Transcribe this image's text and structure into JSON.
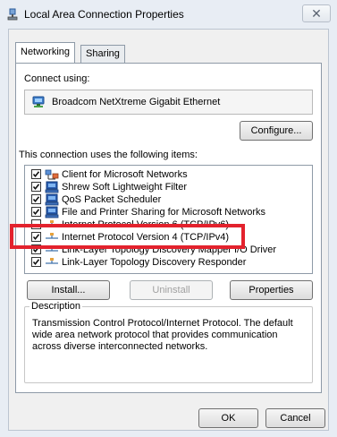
{
  "window": {
    "title": "Local Area Connection Properties",
    "close_glyph": "✕"
  },
  "tabs": [
    {
      "label": "Networking",
      "selected": true
    },
    {
      "label": "Sharing",
      "selected": false
    }
  ],
  "connect_using": {
    "label": "Connect using:",
    "adapter": "Broadcom NetXtreme Gigabit Ethernet",
    "adapter_icon": "network-adapter-icon",
    "configure_label": "Configure..."
  },
  "items_section": {
    "label": "This connection uses the following items:",
    "items": [
      {
        "label": "Client for Microsoft Networks",
        "checked": true,
        "icon": "network-client-icon"
      },
      {
        "label": "Shrew Soft Lightweight Filter",
        "checked": true,
        "icon": "network-service-icon"
      },
      {
        "label": "QoS Packet Scheduler",
        "checked": true,
        "icon": "network-service-icon"
      },
      {
        "label": "File and Printer Sharing for Microsoft Networks",
        "checked": true,
        "icon": "network-service-icon"
      },
      {
        "label": "Internet Protocol Version 6 (TCP/IPv6)",
        "checked": false,
        "icon": "protocol-icon"
      },
      {
        "label": "Internet Protocol Version 4 (TCP/IPv4)",
        "checked": true,
        "icon": "protocol-icon"
      },
      {
        "label": "Link-Layer Topology Discovery Mapper I/O Driver",
        "checked": true,
        "icon": "protocol-icon"
      },
      {
        "label": "Link-Layer Topology Discovery Responder",
        "checked": true,
        "icon": "protocol-icon"
      }
    ]
  },
  "actions": {
    "install_label": "Install...",
    "uninstall_label": "Uninstall",
    "properties_label": "Properties"
  },
  "description": {
    "legend": "Description",
    "text": "Transmission Control Protocol/Internet Protocol. The default wide area network protocol that provides communication across diverse interconnected networks."
  },
  "footer": {
    "ok_label": "OK",
    "cancel_label": "Cancel"
  },
  "colors": {
    "highlight": "#e3222d"
  }
}
